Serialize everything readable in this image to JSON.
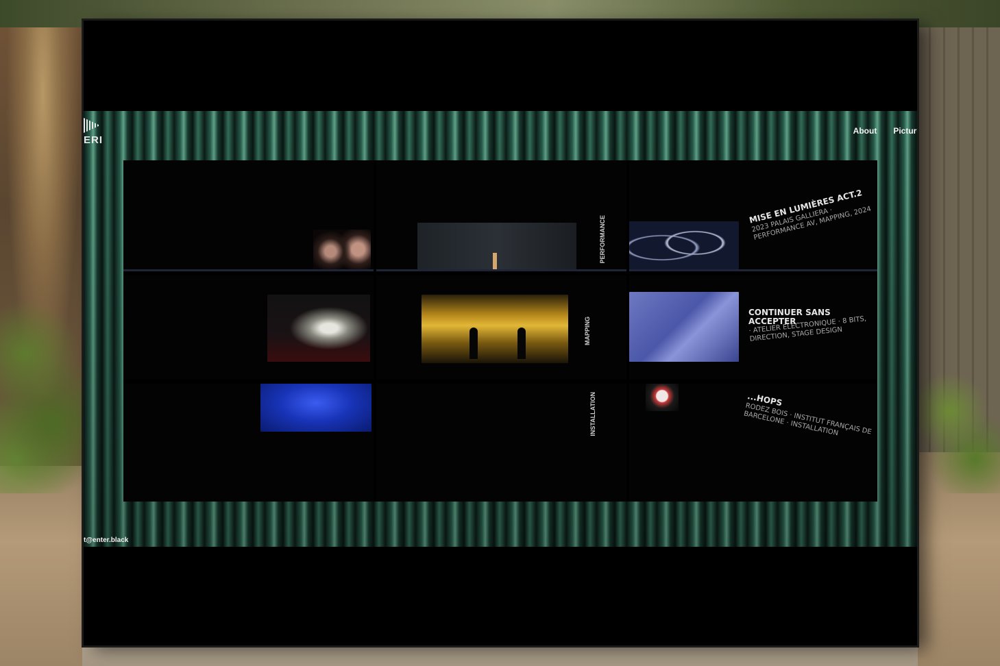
{
  "site": {
    "logo_text": "ERI",
    "nav": [
      "About",
      "Picture"
    ],
    "email": "t@enter.black"
  },
  "projects": [
    {
      "title": "Mise en Lumières Act.2",
      "meta": "2023 Palais Galliera · Performance AV, Mapping, 2024"
    },
    {
      "title": "Continuer sans accepter",
      "meta": "· Atelier Electronique · 8 bits, direction, stage design"
    },
    {
      "title": "...hops",
      "meta": "Rodez Bois · Institut Français de Barcelone · Installation"
    }
  ],
  "vertical_labels": [
    "Performance",
    "Mapping",
    "Installation"
  ],
  "colors": {
    "site_accent": "#6fbfa0",
    "background": "#000000",
    "text": "#e6e6e6"
  }
}
